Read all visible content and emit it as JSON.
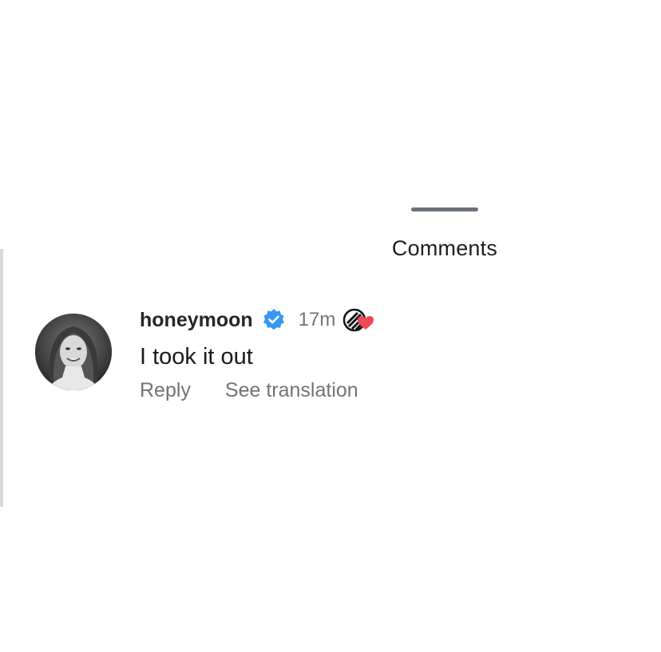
{
  "sheet": {
    "title": "Comments"
  },
  "comment": {
    "username": "honeymoon",
    "verified": true,
    "time": "17m",
    "text": "I took it out",
    "actions": {
      "reply": "Reply",
      "translate": "See translation"
    },
    "icons": {
      "avatar": "profile-photo",
      "badge": "verified-badge-icon",
      "liked_by_creator": "creator-heart-icon"
    }
  },
  "colors": {
    "verified": "#3797f0",
    "heart": "#ed4956",
    "secondary_text": "#737373",
    "primary_text": "#262626"
  }
}
